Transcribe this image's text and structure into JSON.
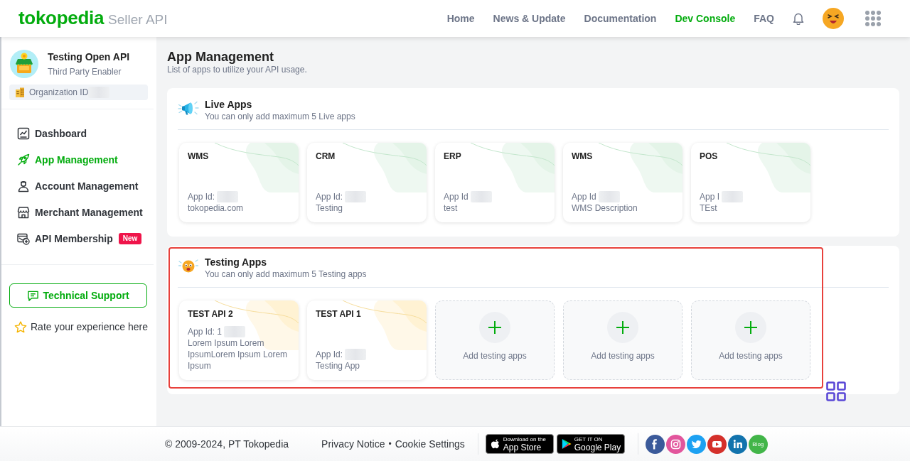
{
  "header": {
    "logo": {
      "brand": "tokopedia",
      "product": "Seller API"
    },
    "nav": [
      {
        "label": "Home",
        "selected": false
      },
      {
        "label": "News & Update",
        "selected": false
      },
      {
        "label": "Documentation",
        "selected": false
      },
      {
        "label": "Dev Console",
        "selected": true
      },
      {
        "label": "FAQ",
        "selected": false
      }
    ]
  },
  "sidebar": {
    "profile": {
      "name": "Testing Open API",
      "role": "Third Party Enabler",
      "org_label": "Organization ID"
    },
    "items": [
      {
        "label": "Dashboard",
        "selected": false
      },
      {
        "label": "App Management",
        "selected": true
      },
      {
        "label": "Account Management",
        "selected": false
      },
      {
        "label": "Merchant Management",
        "selected": false
      },
      {
        "label": "API Membership",
        "selected": false,
        "badge": "New"
      }
    ],
    "support_button": "Technical Support",
    "rate_link": "Rate your experience here"
  },
  "page": {
    "title": "App Management",
    "subtitle": "List of apps to utilize your API usage."
  },
  "sections": [
    {
      "kind": "live",
      "title": "Live Apps",
      "subtitle": "You can only add maximum 5 Live apps",
      "highlighted": false,
      "apps": [
        {
          "kind": "app",
          "name": "WMS",
          "app_id_label": "App Id:",
          "description": "tokopedia.com"
        },
        {
          "kind": "app",
          "name": "CRM",
          "app_id_label": "App Id:",
          "description": "Testing"
        },
        {
          "kind": "app",
          "name": "ERP",
          "app_id_label": "App Id",
          "description": "test"
        },
        {
          "kind": "app",
          "name": "WMS",
          "app_id_label": "App Id",
          "description": "WMS Description"
        },
        {
          "kind": "app",
          "name": "POS",
          "app_id_label": "App I",
          "description": "TEst"
        }
      ]
    },
    {
      "kind": "testing",
      "title": "Testing Apps",
      "subtitle": "You can only add maximum 5 Testing apps",
      "highlighted": true,
      "apps": [
        {
          "kind": "app",
          "name": "TEST API 2",
          "app_id_label": "App Id: 1",
          "description": "Lorem Ipsum Lorem IpsumLorem Ipsum Lorem Ipsum"
        },
        {
          "kind": "app",
          "name": "TEST API 1",
          "app_id_label": "App Id:",
          "description": "Testing App"
        },
        {
          "kind": "add",
          "label": "Add testing apps"
        },
        {
          "kind": "add",
          "label": "Add testing apps"
        },
        {
          "kind": "add",
          "label": "Add testing apps"
        }
      ]
    }
  ],
  "footer": {
    "copyright": "© 2009-2024, PT Tokopedia",
    "links": [
      "Privacy Notice",
      "Cookie Settings"
    ],
    "separator": "•",
    "stores": [
      {
        "kind": "apple",
        "caption": "Download on the",
        "name": "App Store"
      },
      {
        "kind": "google",
        "caption": "GET IT ON",
        "name": "Google Play"
      }
    ],
    "social": [
      {
        "kind": "facebook"
      },
      {
        "kind": "instagram"
      },
      {
        "kind": "twitter"
      },
      {
        "kind": "youtube"
      },
      {
        "kind": "linkedin"
      },
      {
        "kind": "blog",
        "label": "Blog"
      }
    ]
  }
}
